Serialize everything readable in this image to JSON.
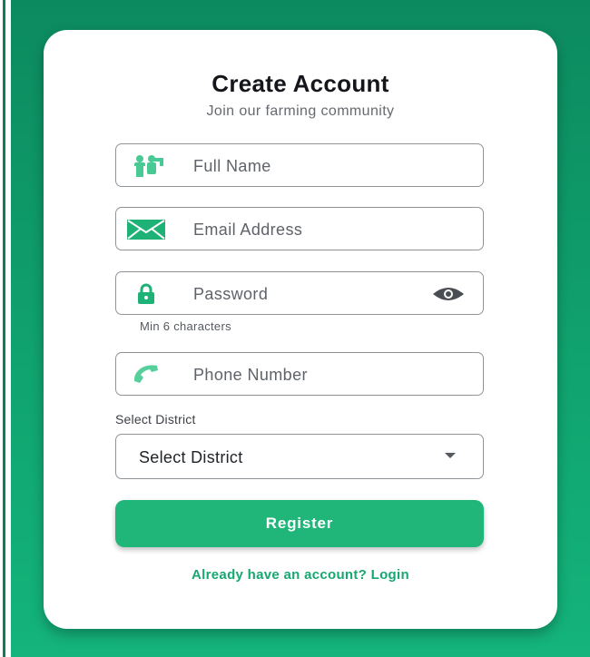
{
  "theme": {
    "accent": "#20b67a",
    "background_gradient": [
      "#0c8a5f",
      "#14b47c"
    ],
    "icon_green": "#1fb277",
    "link_color": "#16a870"
  },
  "header": {
    "title": "Create Account",
    "subtitle": "Join our farming community"
  },
  "form": {
    "full_name": {
      "placeholder": "Full Name",
      "icon": "people-icon"
    },
    "email": {
      "placeholder": "Email Address",
      "icon": "envelope-icon"
    },
    "password": {
      "placeholder": "Password",
      "icon": "lock-icon",
      "toggle_icon": "eye-icon",
      "hint": "Min 6 characters"
    },
    "phone": {
      "placeholder": "Phone Number",
      "icon": "phone-icon"
    },
    "district": {
      "label": "Select District",
      "selected": "Select District",
      "icon": "chevron-down-icon"
    }
  },
  "actions": {
    "register_label": "Register",
    "login_link": "Already have an account? Login"
  }
}
